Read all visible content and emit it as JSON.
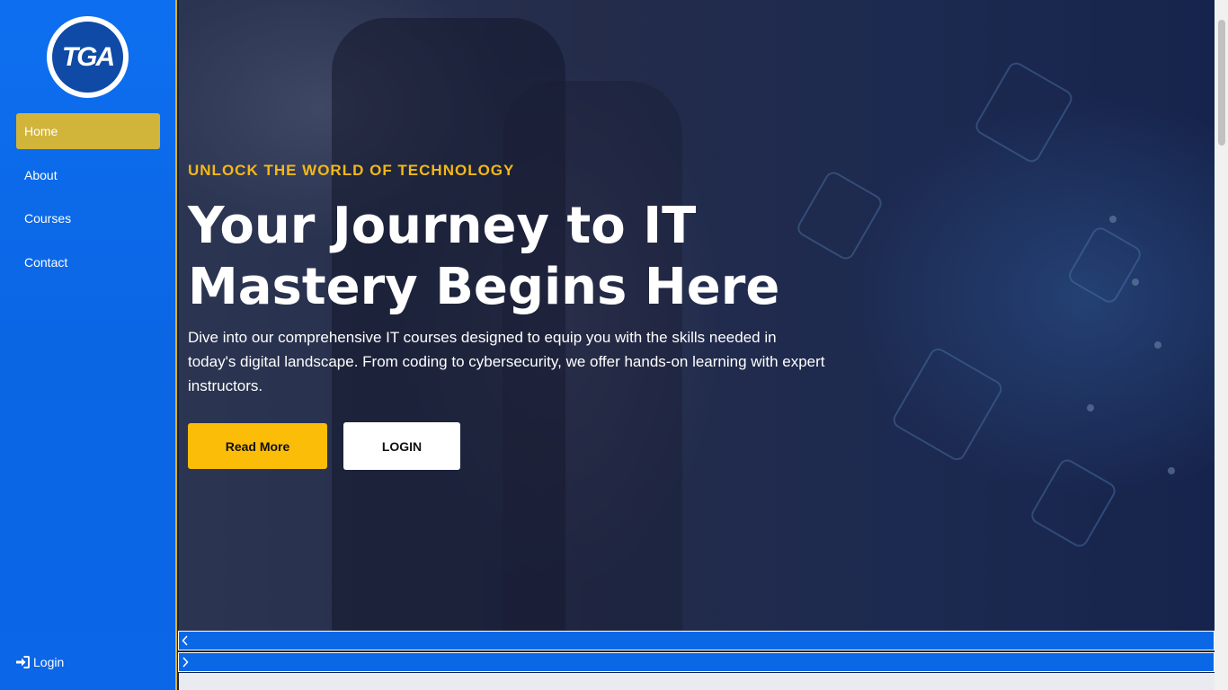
{
  "sidebar": {
    "logo_text": "TGA",
    "nav": [
      {
        "label": "Home",
        "active": true
      },
      {
        "label": "About",
        "active": false
      },
      {
        "label": "Courses",
        "active": false
      },
      {
        "label": "Contact",
        "active": false
      }
    ],
    "login_label": "Login",
    "login_icon": "sign-in-icon"
  },
  "hero": {
    "tagline": "UNLOCK THE WORLD OF TECHNOLOGY",
    "headline": "Your Journey to IT Mastery Begins Here",
    "description": "Dive into our comprehensive IT courses designed to equip you with the skills needed in today's digital landscape. From coding to cybersecurity, we offer hands-on learning with expert instructors.",
    "read_more_label": "Read More",
    "login_button_label": "LOGIN"
  },
  "carousel": {
    "prev_icon": "chevron-left-icon",
    "next_icon": "chevron-right-icon"
  },
  "colors": {
    "sidebar_bg": "#0b6be8",
    "active_nav": "#d1b43a",
    "accent_yellow": "#fbbd08",
    "tagline_color": "#f4b816"
  }
}
